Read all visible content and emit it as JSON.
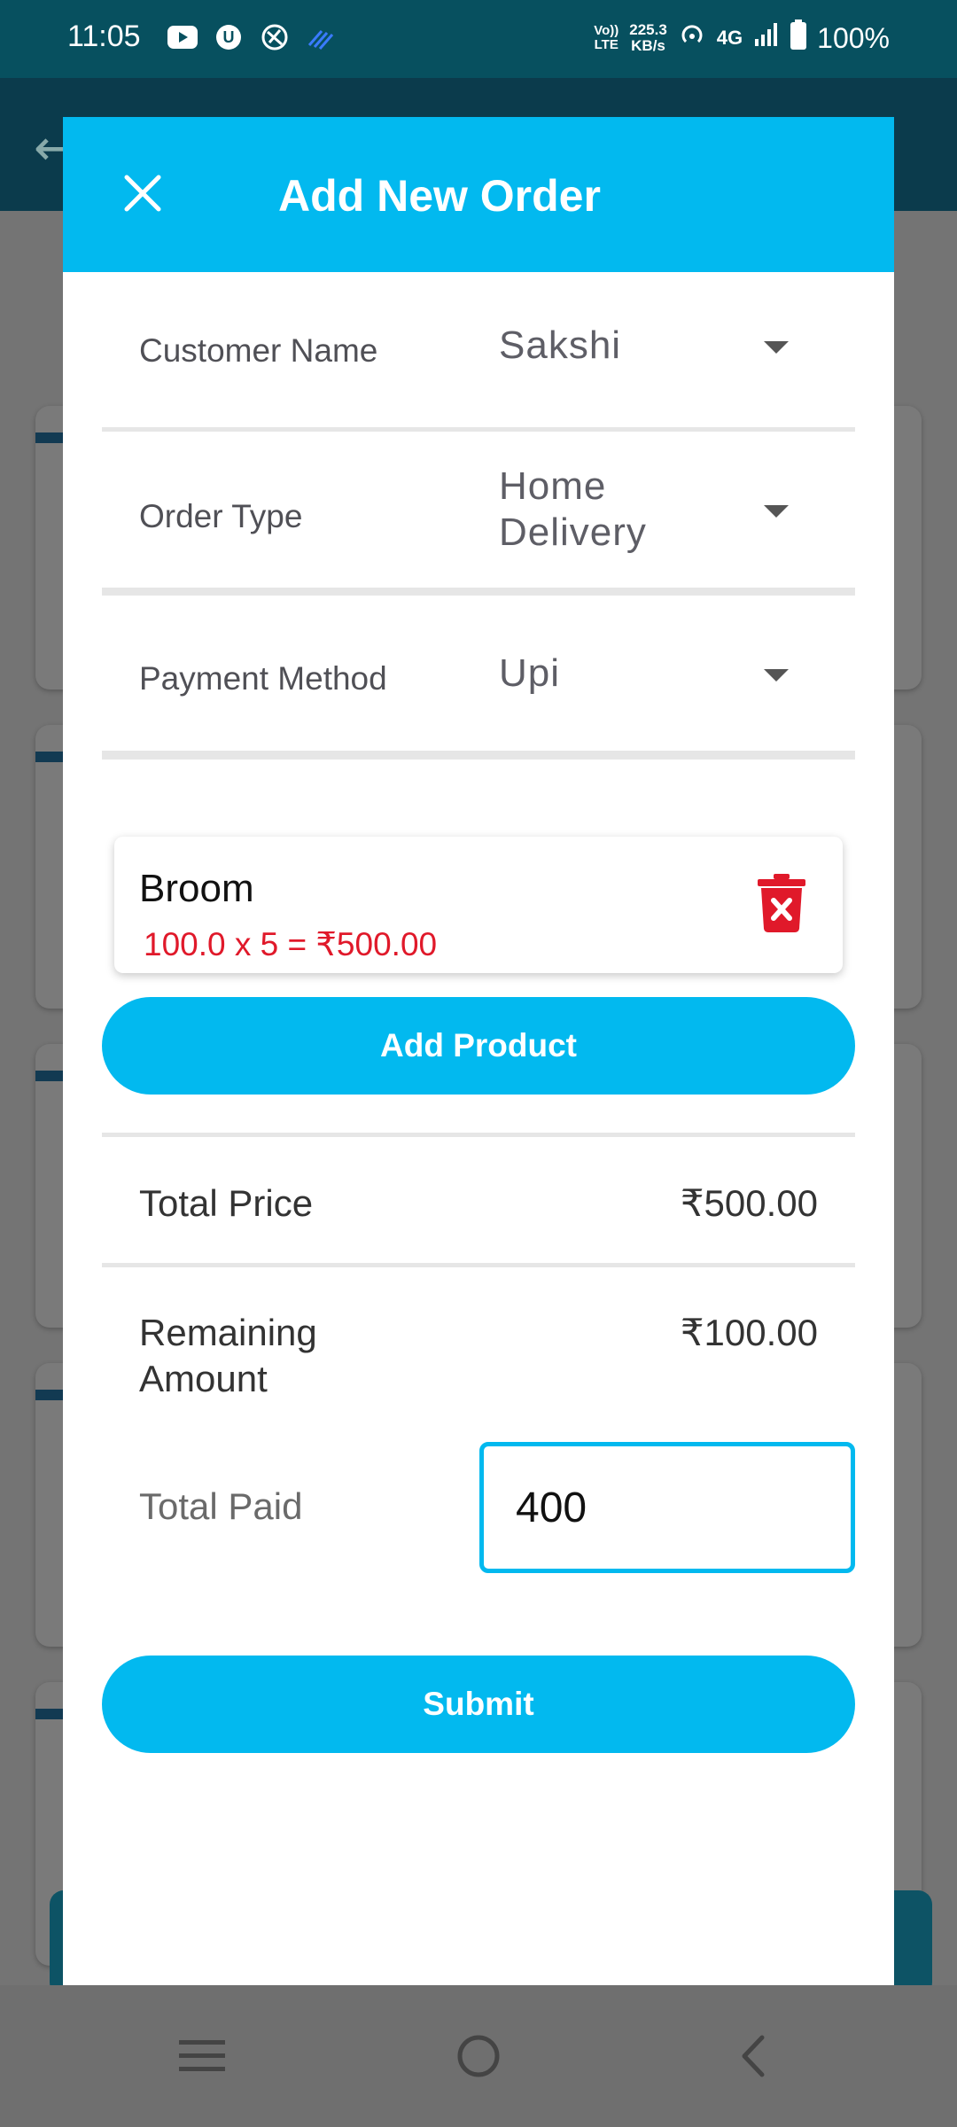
{
  "status_bar": {
    "time": "11:05",
    "network_volte": "Vo))",
    "network_lte": "LTE",
    "speed_value": "225.3",
    "speed_unit": "KB/s",
    "network_type": "4G",
    "battery": "100%"
  },
  "dialog": {
    "title": "Add New Order",
    "fields": [
      {
        "label": "Customer Name",
        "value": "Sakshi"
      },
      {
        "label": "Order Type",
        "value_line1": "Home",
        "value_line2": "Delivery"
      },
      {
        "label": "Payment Method",
        "value": "Upi"
      }
    ],
    "products": [
      {
        "name": "Broom",
        "calc": "100.0 x 5 = ₹500.00"
      }
    ],
    "add_product_label": "Add Product",
    "summary": {
      "total_price_label": "Total Price",
      "total_price_value": "₹500.00",
      "remaining_label_line1": "Remaining",
      "remaining_label_line2": "Amount",
      "remaining_value": "₹100.00",
      "total_paid_label": "Total Paid",
      "total_paid_value": "400"
    },
    "submit_label": "Submit"
  },
  "colors": {
    "accent": "#02b9ef",
    "status_bar": "#07505f",
    "error_red": "#e0192a"
  },
  "icons": {
    "close": "close-icon",
    "dropdown": "caret-down-icon",
    "delete": "trash-icon"
  }
}
